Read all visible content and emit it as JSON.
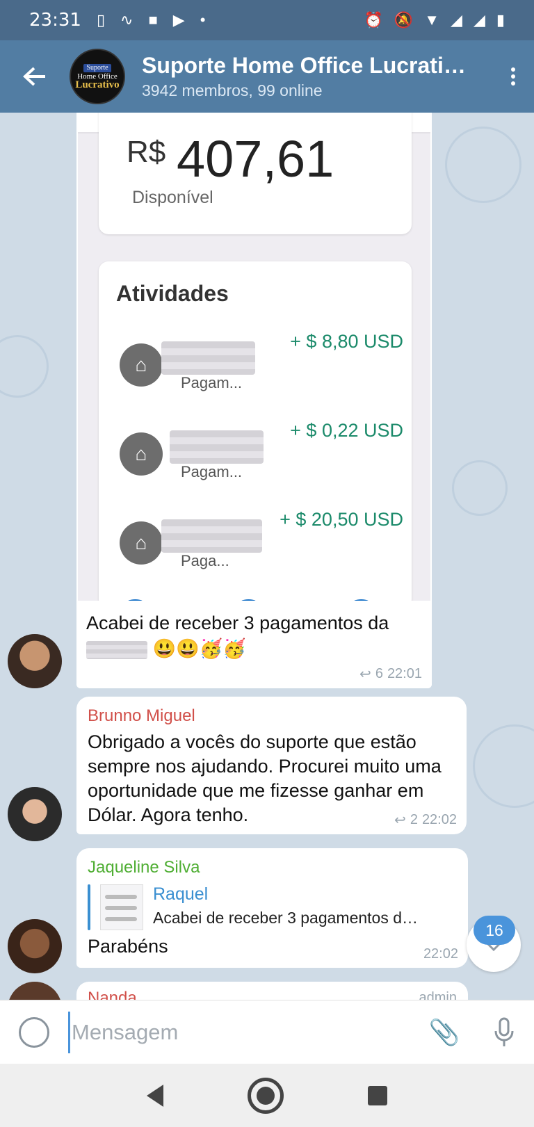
{
  "status_bar": {
    "time": "23:31"
  },
  "header": {
    "title": "Suporte Home Office Lucrati…",
    "subtitle": "3942 membros, 99 online",
    "avatar_lines": [
      "Suporte",
      "Home Office",
      "Lucrativo"
    ]
  },
  "image_message": {
    "currency": "R$",
    "amount": "407,61",
    "available_label": "Disponível",
    "activities_title": "Atividades",
    "activities": [
      {
        "amount": "+ $ 8,80 USD",
        "subtitle": "Pagam..."
      },
      {
        "amount": "+ $ 0,22 USD",
        "subtitle": "Pagam..."
      },
      {
        "amount": "+ $ 20,50 USD",
        "subtitle": "Paga..."
      }
    ],
    "caption": "Acabei de receber 3 pagamentos da",
    "emojis": "😃😃🥳🥳",
    "replies": "6",
    "time": "22:01"
  },
  "messages": [
    {
      "sender": "Brunno Miguel",
      "sender_color": "#d1504a",
      "text": "Obrigado a vocês do suporte que estão sempre nos ajudando. Procurei muito uma oportunidade que me fizesse ganhar em Dólar. Agora tenho.",
      "replies": "2",
      "time": "22:02"
    },
    {
      "sender": "Jaqueline Silva",
      "sender_color": "#4fae33",
      "reply_name": "Raquel",
      "reply_text": "Acabei de receber 3 pagamentos d…",
      "text": "Parabéns",
      "time": "22:02"
    },
    {
      "sender": "Nanda",
      "sender_color": "#d1504a",
      "badge": "admin"
    }
  ],
  "scroll": {
    "unread_count": "16"
  },
  "input": {
    "placeholder": "Mensagem"
  },
  "icons": [
    "back-arrow-icon",
    "more-vertical-icon",
    "emoji-icon",
    "paperclip-icon",
    "microphone-icon",
    "chevron-down-icon",
    "reply-icon",
    "store-icon"
  ]
}
